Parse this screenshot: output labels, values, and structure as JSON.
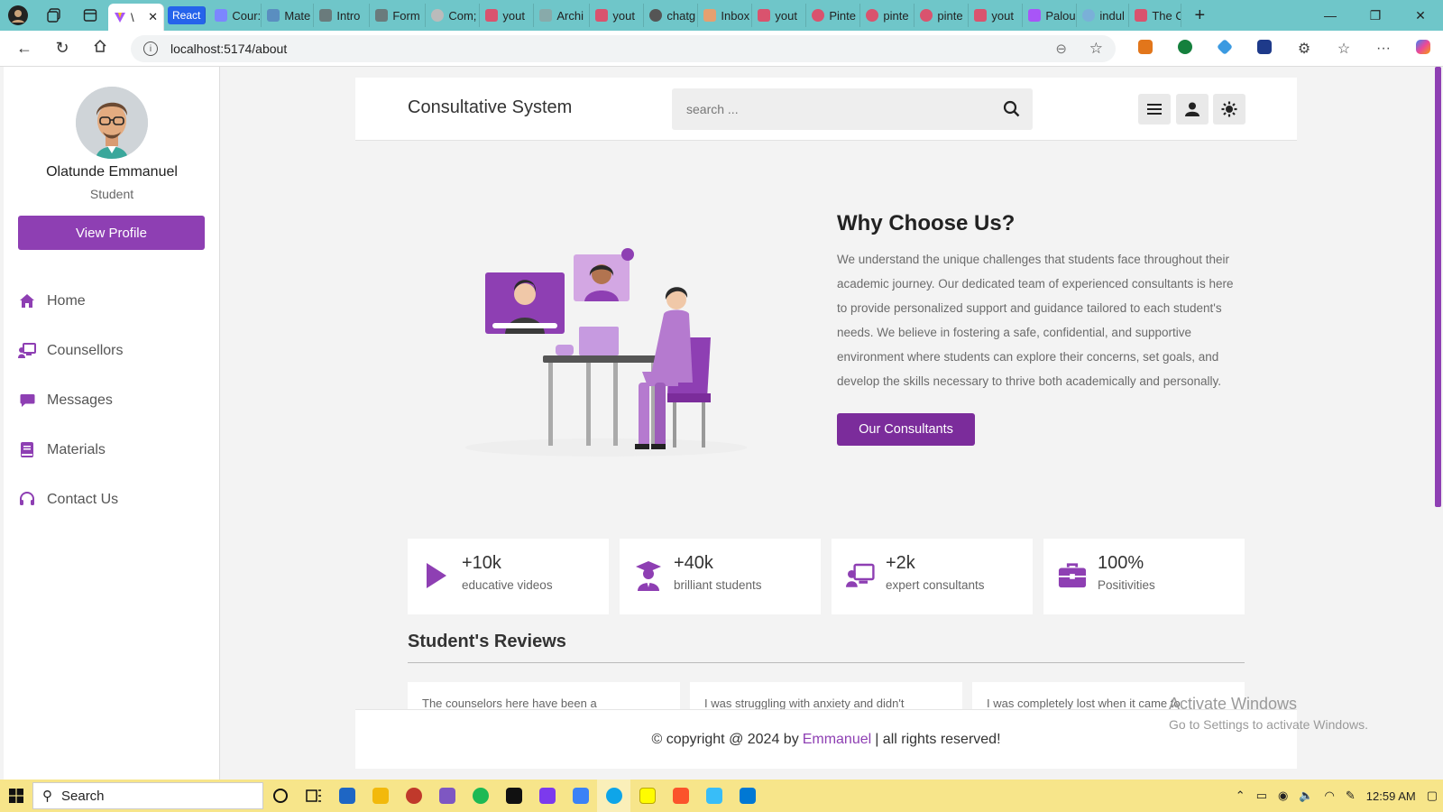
{
  "browser": {
    "active_tab_title": "\\",
    "tabs": [
      "React",
      "Cour:",
      "Mate",
      "Intro",
      "Form",
      "Com;",
      "yout",
      "Archi",
      "yout",
      "chatg",
      "Inbox",
      "yout",
      "Pinte",
      "pinte",
      "pinte",
      "yout",
      "Palou",
      "indul",
      "The C"
    ],
    "url": "localhost:5174/about"
  },
  "sidebar": {
    "user_name": "Olatunde Emmanuel",
    "user_role": "Student",
    "view_profile_label": "View Profile",
    "items": [
      {
        "label": "Home",
        "icon": "home-icon"
      },
      {
        "label": "Counsellors",
        "icon": "counsellor-icon"
      },
      {
        "label": "Messages",
        "icon": "message-icon"
      },
      {
        "label": "Materials",
        "icon": "book-icon"
      },
      {
        "label": "Contact Us",
        "icon": "headset-icon"
      }
    ]
  },
  "header": {
    "brand": "Consultative System",
    "search_placeholder": "search ..."
  },
  "hero": {
    "title": "Why Choose Us?",
    "text": "We understand the unique challenges that students face throughout their academic journey. Our dedicated team of experienced consultants is here to provide personalized support and guidance tailored to each student's needs. We believe in fostering a safe, confidential, and supportive environment where students can explore their concerns, set goals, and develop the skills necessary to thrive both academically and personally.",
    "button_label": "Our Consultants"
  },
  "stats": [
    {
      "value": "+10k",
      "label": "educative videos",
      "icon": "play-icon"
    },
    {
      "value": "+40k",
      "label": "brilliant students",
      "icon": "graduate-icon"
    },
    {
      "value": "+2k",
      "label": "expert consultants",
      "icon": "teacher-icon"
    },
    {
      "value": "100%",
      "label": "Positivities",
      "icon": "briefcase-icon"
    }
  ],
  "reviews": {
    "title": "Student's Reviews",
    "cards": [
      "The counselors here have been a",
      "I was struggling with anxiety and didn't",
      "I was completely lost when it came to"
    ]
  },
  "footer": {
    "prefix": "© copyright @ 2024 by",
    "author": "Emmanuel",
    "suffix": "| all rights reserved!"
  },
  "watermark": {
    "line1": "Activate Windows",
    "line2": "Go to Settings to activate Windows."
  },
  "taskbar": {
    "search_label": "Search",
    "time": "12:59 AM"
  },
  "colors": {
    "accent": "#8e3fb3",
    "button_dark": "#7b2c9b",
    "tab_bar": "#6fc6c9",
    "taskbar": "#f7e58a"
  }
}
